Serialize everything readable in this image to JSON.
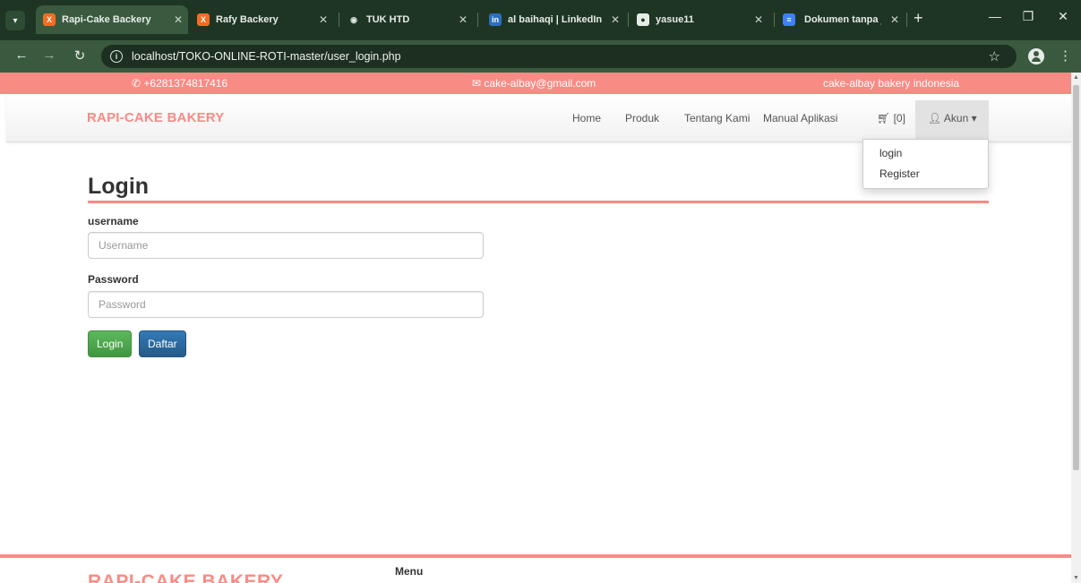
{
  "browser": {
    "tabs": [
      {
        "title": "Rapi-Cake Backery",
        "favicon": "xampp-icon",
        "active": true
      },
      {
        "title": "Rafy Backery",
        "favicon": "xampp-icon",
        "active": false
      },
      {
        "title": "TUK HTD",
        "favicon": "globe-icon",
        "active": false
      },
      {
        "title": "al baihaqi | LinkedIn",
        "favicon": "linkedin-icon",
        "active": false
      },
      {
        "title": "yasue11",
        "favicon": "github-icon",
        "active": false
      },
      {
        "title": "Dokumen tanpa judu",
        "favicon": "google-docs-icon",
        "active": false
      }
    ],
    "url": "localhost/TOKO-ONLINE-ROTI-master/user_login.php"
  },
  "topbar": {
    "phone": "+6281374817416",
    "email": "cake-albay@gmail.com",
    "tagline": "cake-albay bakery indonesia"
  },
  "navbar": {
    "brand": "RAPI-CAKE BAKERY",
    "links": [
      "Home",
      "Produk",
      "Tentang Kami",
      "Manual Aplikasi"
    ],
    "cart": "[0]",
    "account": "Akun"
  },
  "account_menu": {
    "items": [
      "login",
      "Register"
    ]
  },
  "login_form": {
    "title": "Login",
    "username_label": "username",
    "username_placeholder": "Username",
    "password_label": "Password",
    "password_placeholder": "Password",
    "login_button": "Login",
    "register_button": "Daftar"
  },
  "footer": {
    "brand": "RAPI-CAKE BAKERY",
    "menu_heading": "Menu"
  },
  "colors": {
    "brand": "#f98b85",
    "chrome": "#3a5a40",
    "success": "#5cb85c",
    "primary": "#337ab7"
  }
}
